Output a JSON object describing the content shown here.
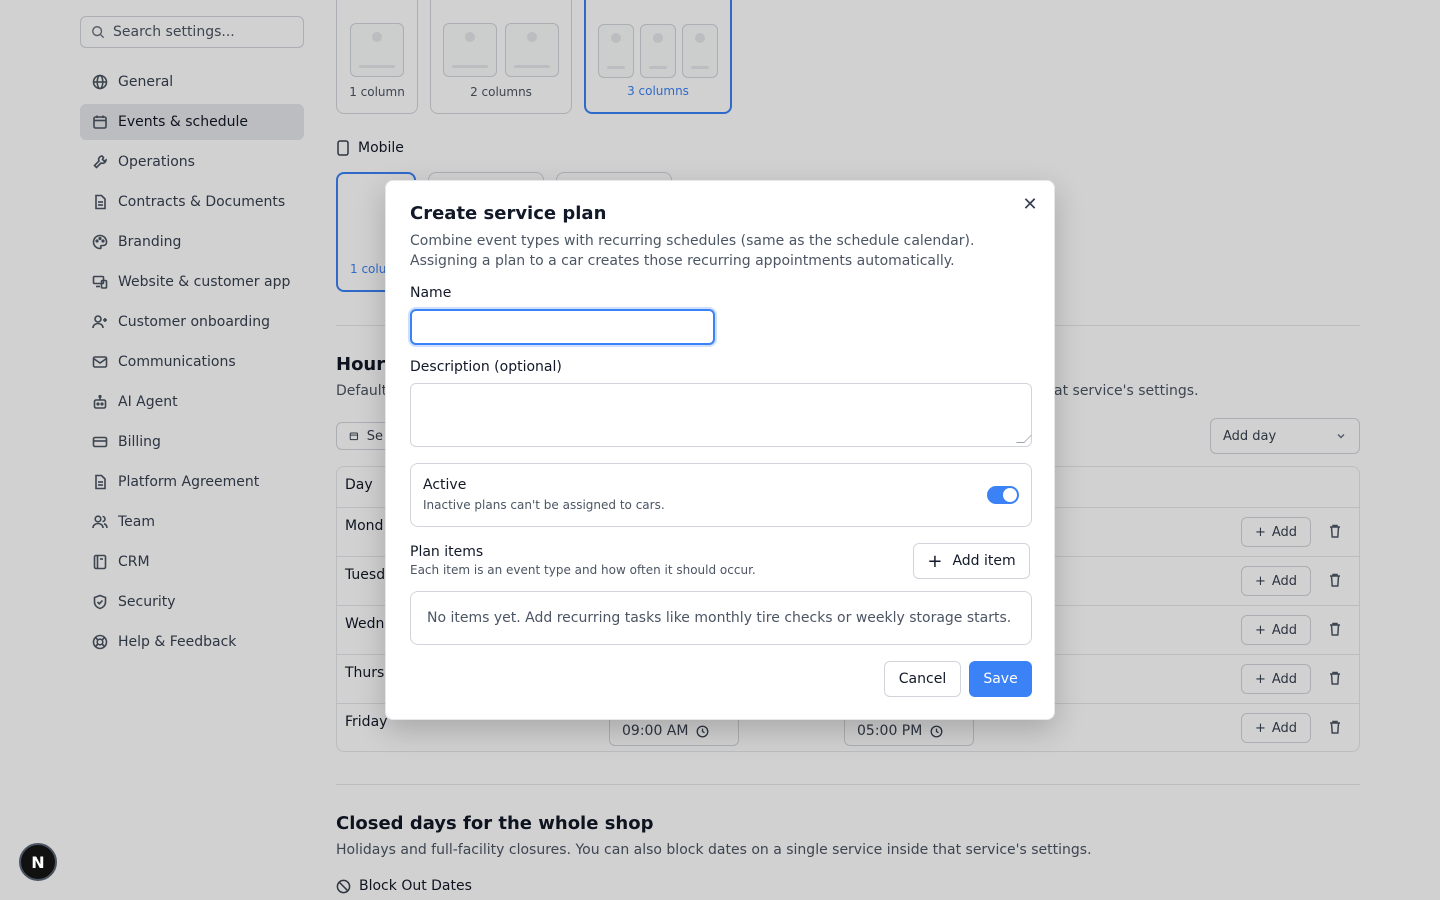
{
  "sidebar": {
    "search_placeholder": "Search settings...",
    "items": [
      {
        "label": "General",
        "icon": "globe-icon"
      },
      {
        "label": "Events & schedule",
        "icon": "calendar-icon",
        "active": true
      },
      {
        "label": "Operations",
        "icon": "wrench-icon"
      },
      {
        "label": "Contracts & Documents",
        "icon": "document-icon"
      },
      {
        "label": "Branding",
        "icon": "palette-icon"
      },
      {
        "label": "Website & customer app",
        "icon": "devices-icon"
      },
      {
        "label": "Customer onboarding",
        "icon": "user-plus-icon"
      },
      {
        "label": "Communications",
        "icon": "mail-icon"
      },
      {
        "label": "AI Agent",
        "icon": "bot-icon"
      },
      {
        "label": "Billing",
        "icon": "credit-card-icon"
      },
      {
        "label": "Platform Agreement",
        "icon": "document-icon"
      },
      {
        "label": "Team",
        "icon": "users-icon"
      },
      {
        "label": "CRM",
        "icon": "contacts-icon"
      },
      {
        "label": "Security",
        "icon": "shield-icon"
      },
      {
        "label": "Help & Feedback",
        "icon": "lifebuoy-icon"
      }
    ]
  },
  "background": {
    "layout_options": [
      "1 column",
      "2 columns",
      "3 columns"
    ],
    "mobile_label": "Mobile",
    "mobile_option_partial": "1 colu",
    "hours_title_partial": "Hours",
    "hours_sub_left": "Default",
    "hours_sub_right": "at service's settings.",
    "calendar_btn_partial": "Se",
    "add_day_label": "Add day",
    "table_header": "Day",
    "days": [
      "Mond",
      "Tuesd",
      "Wedn",
      "Thurs",
      "Friday"
    ],
    "add_label": "Add",
    "friday_open": "09:00 AM",
    "friday_close": "05:00 PM",
    "closed_title": "Closed days for the whole shop",
    "closed_sub": "Holidays and full-facility closures. You can also block dates on a single service inside that service's settings.",
    "block_out": "Block Out Dates"
  },
  "dialog": {
    "title": "Create service plan",
    "description": "Combine event types with recurring schedules (same as the schedule calendar). Assigning a plan to a car creates those recurring appointments automatically.",
    "name_label": "Name",
    "name_value": "",
    "description_label": "Description (optional)",
    "active_title": "Active",
    "active_sub": "Inactive plans can't be assigned to cars.",
    "active_on": true,
    "plan_items_title": "Plan items",
    "plan_items_sub": "Each item is an event type and how often it should occur.",
    "add_item": "Add item",
    "empty_text": "No items yet. Add recurring tasks like monthly tire checks or weekly storage starts.",
    "cancel": "Cancel",
    "save": "Save"
  },
  "fab_letter": "N",
  "colors": {
    "accent": "#3b82f6"
  }
}
